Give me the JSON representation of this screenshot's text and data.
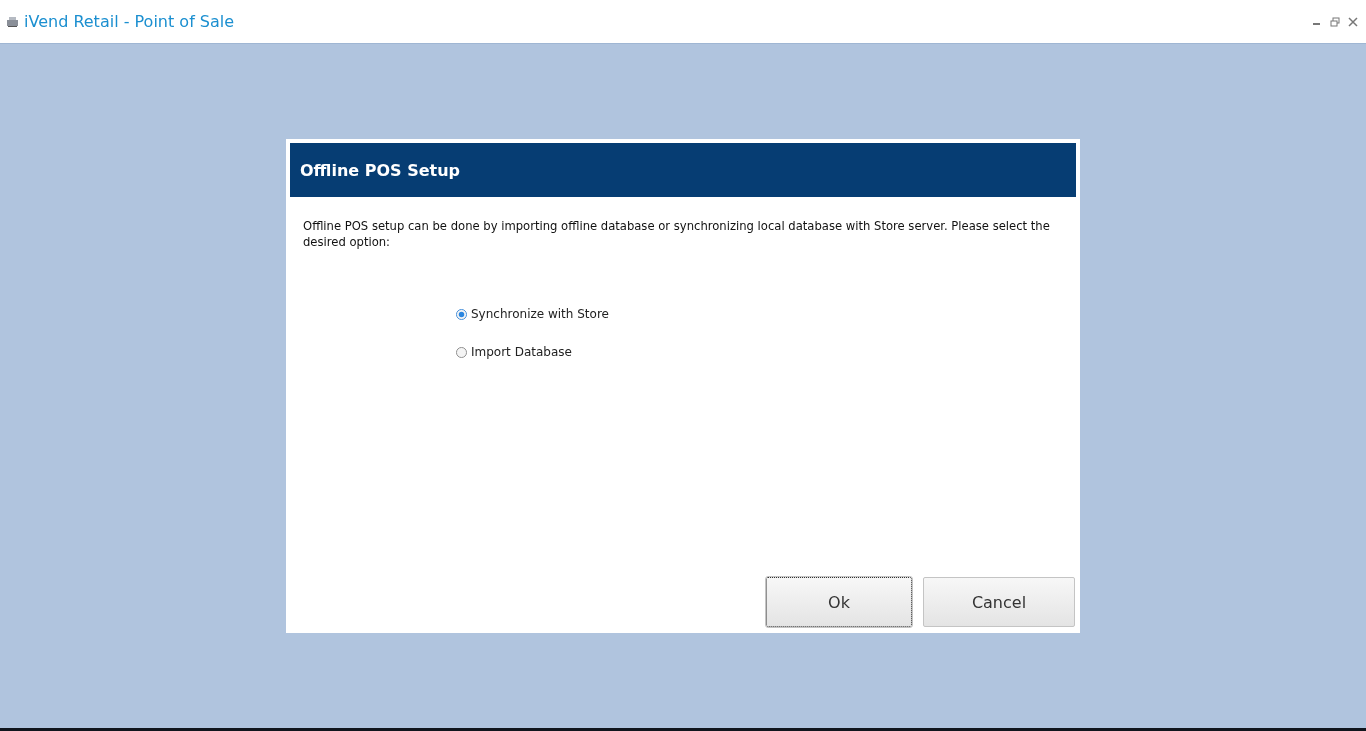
{
  "window": {
    "title": "iVend Retail - Point of Sale"
  },
  "dialog": {
    "title": "Offline POS Setup",
    "message": "Offline POS setup can be done by importing offline database or synchronizing local database with Store server. Please select the desired option:",
    "options": [
      {
        "label": "Synchronize with Store",
        "selected": true
      },
      {
        "label": "Import Database",
        "selected": false
      }
    ],
    "buttons": [
      {
        "label": "Ok",
        "focused": true
      },
      {
        "label": "Cancel",
        "focused": false
      }
    ]
  }
}
